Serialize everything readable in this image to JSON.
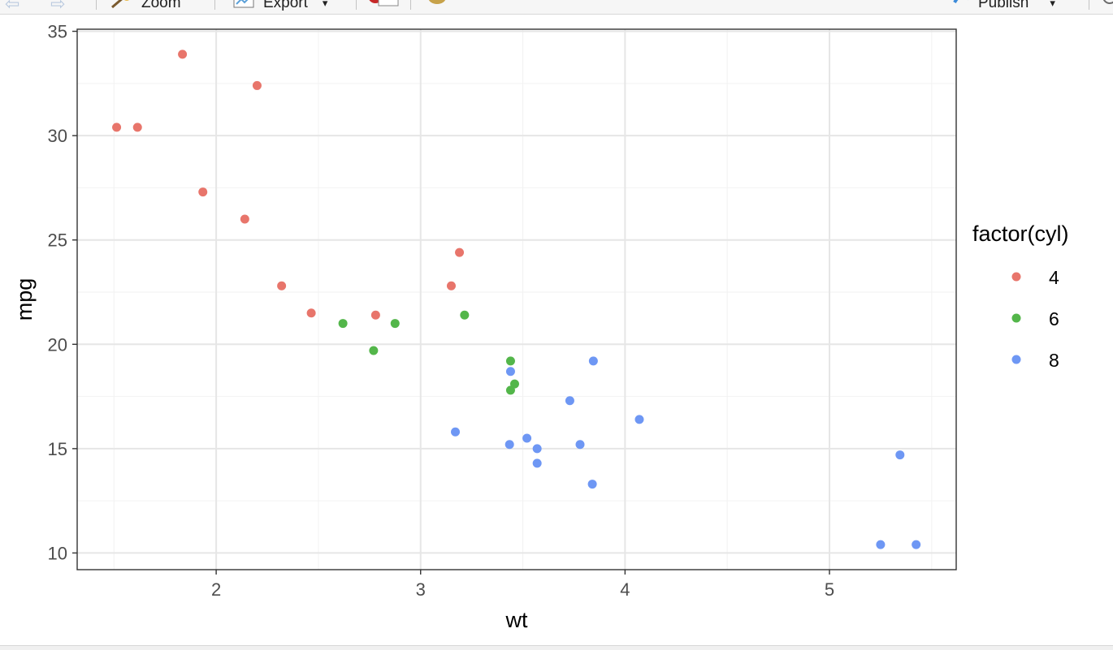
{
  "toolbar": {
    "zoom_label": "Zoom",
    "export_label": "Export",
    "export_arrow": "▾",
    "publish_label": "Publish",
    "publish_arrow": "▾",
    "icons": [
      "back-arrow-icon",
      "forward-arrow-icon",
      "zoom-icon",
      "export-icon",
      "remove-plot-icon",
      "clear-all-icon",
      "broom-icon",
      "publish-icon",
      "refresh-icon"
    ]
  },
  "colors": {
    "4": "#E8756B",
    "6": "#53B64A",
    "8": "#6E97F4",
    "panel_border": "#333333",
    "grid_major": "#e6e6e6",
    "grid_minor": "#f2f2f2"
  },
  "chart_data": {
    "type": "scatter",
    "xlabel": "wt",
    "ylabel": "mpg",
    "xlim": [
      1.32,
      5.62
    ],
    "ylim": [
      9.2,
      35.1
    ],
    "xticks": [
      2,
      3,
      4,
      5
    ],
    "yticks": [
      10,
      15,
      20,
      25,
      30,
      35
    ],
    "grid": true,
    "legend": {
      "title": "factor(cyl)",
      "placement": "right",
      "entries": [
        "4",
        "6",
        "8"
      ]
    },
    "series": [
      {
        "name": "4",
        "points": [
          [
            2.32,
            22.8
          ],
          [
            3.19,
            24.4
          ],
          [
            3.15,
            22.8
          ],
          [
            2.2,
            32.4
          ],
          [
            1.615,
            30.4
          ],
          [
            1.835,
            33.9
          ],
          [
            2.465,
            21.5
          ],
          [
            1.935,
            27.3
          ],
          [
            2.14,
            26.0
          ],
          [
            1.513,
            30.4
          ],
          [
            2.78,
            21.4
          ]
        ]
      },
      {
        "name": "6",
        "points": [
          [
            2.62,
            21.0
          ],
          [
            2.875,
            21.0
          ],
          [
            3.215,
            21.4
          ],
          [
            3.46,
            18.1
          ],
          [
            3.44,
            19.2
          ],
          [
            3.44,
            17.8
          ],
          [
            2.77,
            19.7
          ]
        ]
      },
      {
        "name": "8",
        "points": [
          [
            3.44,
            18.7
          ],
          [
            3.57,
            14.3
          ],
          [
            4.07,
            16.4
          ],
          [
            3.73,
            17.3
          ],
          [
            3.78,
            15.2
          ],
          [
            5.25,
            10.4
          ],
          [
            5.424,
            10.4
          ],
          [
            5.345,
            14.7
          ],
          [
            3.52,
            15.5
          ],
          [
            3.435,
            15.2
          ],
          [
            3.84,
            13.3
          ],
          [
            3.845,
            19.2
          ],
          [
            3.17,
            15.8
          ],
          [
            3.57,
            15.0
          ]
        ]
      }
    ]
  }
}
